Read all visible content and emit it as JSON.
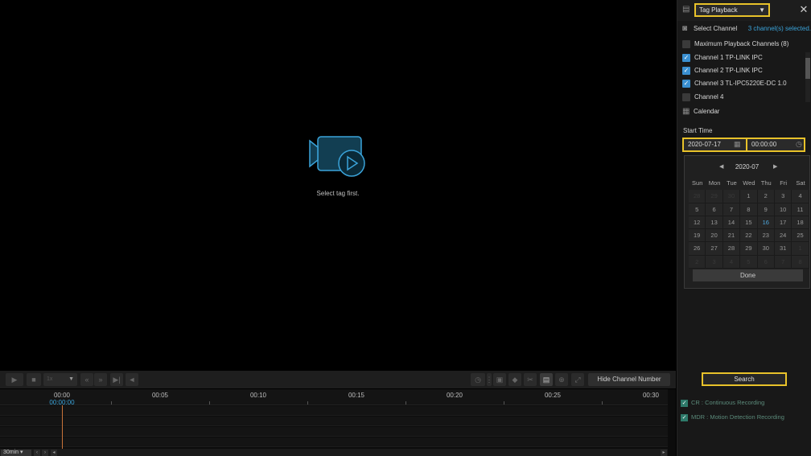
{
  "player": {
    "placeholder_text": "Select tag first."
  },
  "toolbar": {
    "speed_value": "1x",
    "hide_channel_label": "Hide Channel Number"
  },
  "timeline": {
    "ticks": [
      "00:00",
      "00:05",
      "00:10",
      "00:15",
      "00:20",
      "00:25",
      "00:30"
    ],
    "current_time": "00:00:00",
    "zoom": "30min"
  },
  "side": {
    "mode": "Tag Playback",
    "select_channel_label": "Select Channel",
    "selected_count": "3 channel(s) selected.",
    "max_channels_label": "Maximum Playback Channels (8)",
    "channels": [
      {
        "label": "Channel 1 TP-LINK IPC",
        "checked": true
      },
      {
        "label": "Channel 2 TP-LINK IPC",
        "checked": true
      },
      {
        "label": "Channel 3 TL-IPC5220E-DC 1.0",
        "checked": true
      },
      {
        "label": "Channel 4",
        "checked": false
      }
    ],
    "calendar_label": "Calendar",
    "start_time_label": "Start Time",
    "start_date": "2020-07-17",
    "start_clock": "00:00:00",
    "calendar": {
      "month": "2020-07",
      "weekdays": [
        "Sun",
        "Mon",
        "Tue",
        "Wed",
        "Thu",
        "Fri",
        "Sat"
      ],
      "weeks": [
        [
          "28",
          "29",
          "30",
          "1",
          "2",
          "3",
          "4"
        ],
        [
          "5",
          "6",
          "7",
          "8",
          "9",
          "10",
          "11"
        ],
        [
          "12",
          "13",
          "14",
          "15",
          "16",
          "17",
          "18"
        ],
        [
          "19",
          "20",
          "21",
          "22",
          "23",
          "24",
          "25"
        ],
        [
          "26",
          "27",
          "28",
          "29",
          "30",
          "31",
          "1"
        ],
        [
          "2",
          "3",
          "4",
          "5",
          "6",
          "7",
          "8"
        ]
      ],
      "selected_day": "16",
      "done_label": "Done"
    },
    "search_label": "Search",
    "legend": [
      {
        "label": "CR : Continuous Recording"
      },
      {
        "label": "MDR : Motion Detection Recording"
      }
    ]
  },
  "colors": {
    "accent": "#3aa3d9",
    "highlight": "#e8c22a",
    "cursor": "#c8733a"
  }
}
